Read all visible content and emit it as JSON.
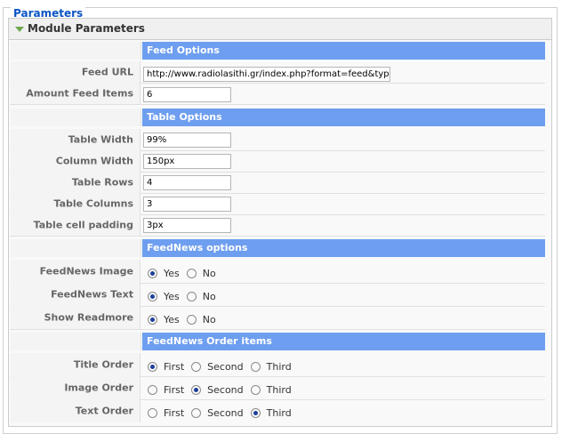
{
  "fieldset": {
    "legend": "Parameters"
  },
  "panel": {
    "title": "Module Parameters"
  },
  "sections": {
    "feed_options": "Feed Options",
    "table_options": "Table Options",
    "feednews_options": "FeedNews options",
    "order_items": "FeedNews Order items"
  },
  "feed": {
    "url_label": "Feed URL",
    "url_value": "http://www.radiolasithi.gr/index.php?format=feed&type=rss",
    "amount_label": "Amount Feed Items",
    "amount_value": "6"
  },
  "table": {
    "width_label": "Table Width",
    "width_value": "99%",
    "colwidth_label": "Column Width",
    "colwidth_value": "150px",
    "rows_label": "Table Rows",
    "rows_value": "4",
    "cols_label": "Table Columns",
    "cols_value": "3",
    "padding_label": "Table cell padding",
    "padding_value": "3px"
  },
  "feednews": {
    "image_label": "FeedNews Image",
    "image_selected": "Yes",
    "text_label": "FeedNews Text",
    "text_selected": "Yes",
    "readmore_label": "Show Readmore",
    "readmore_selected": "Yes",
    "yes": "Yes",
    "no": "No"
  },
  "order": {
    "first": "First",
    "second": "Second",
    "third": "Third",
    "title_label": "Title Order",
    "title_selected": "First",
    "image_label": "Image Order",
    "image_selected": "Second",
    "text_label": "Text Order",
    "text_selected": "Third"
  }
}
